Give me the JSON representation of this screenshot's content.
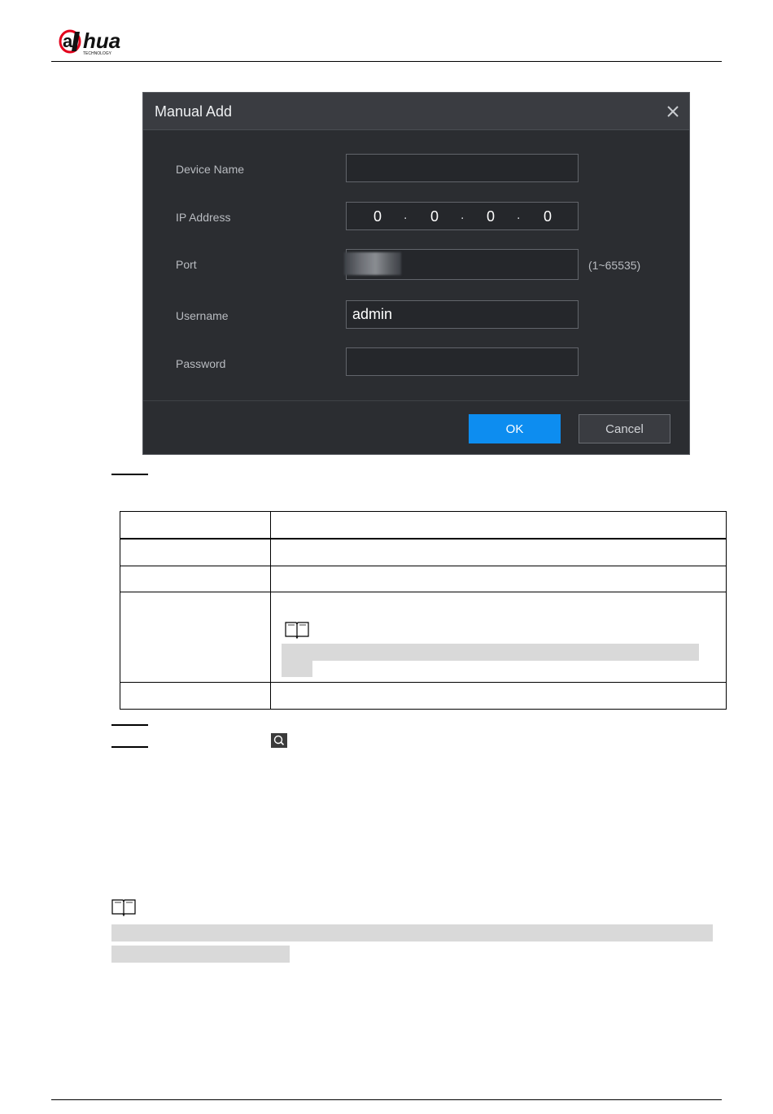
{
  "brand": {
    "logo_text": "alhua",
    "logo_sub": "TECHNOLOGY"
  },
  "dialog": {
    "title": "Manual Add",
    "fields": {
      "device_name": {
        "label": "Device Name",
        "value": ""
      },
      "ip_address": {
        "label": "IP Address",
        "octets": [
          "0",
          "0",
          "0",
          "0"
        ]
      },
      "port": {
        "label": "Port",
        "hint": "(1~65535)"
      },
      "username": {
        "label": "Username",
        "value": "admin"
      },
      "password": {
        "label": "Password",
        "value": ""
      }
    },
    "ok_label": "OK",
    "cancel_label": "Cancel"
  },
  "colors": {
    "dialog_bg": "#2b2d31",
    "titlebar_bg": "#3a3c41",
    "ok_button": "#0d8df0",
    "redaction_grey": "#d9d9d9"
  },
  "icons": [
    "close-icon",
    "book-note-icon",
    "search-icon"
  ]
}
